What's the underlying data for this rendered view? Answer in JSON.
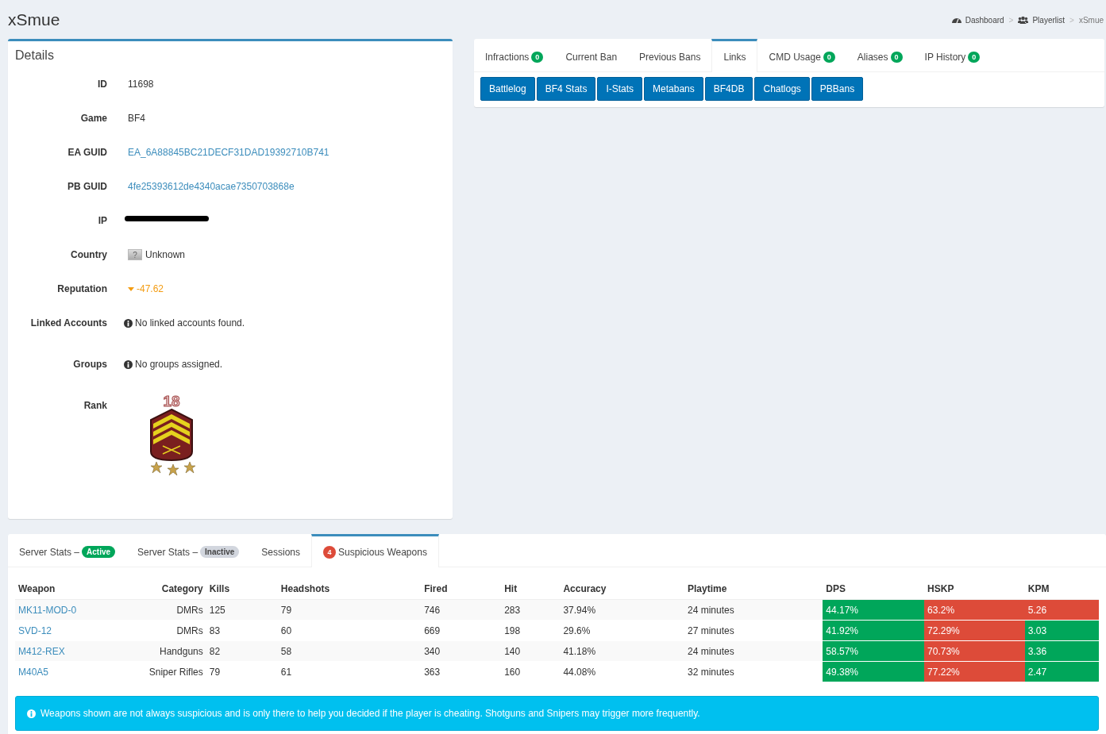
{
  "page_title": "xSmue",
  "breadcrumb": [
    {
      "label": "Dashboard",
      "kind": "dashboard",
      "separator": ">"
    },
    {
      "label": "Playerlist",
      "kind": "players",
      "separator": ">"
    },
    {
      "label": "xSmue",
      "kind": "current"
    }
  ],
  "details": {
    "title": "Details",
    "rows": [
      {
        "label": "ID",
        "kind": "text",
        "value": "11698"
      },
      {
        "label": "Game",
        "kind": "text",
        "value": "BF4"
      },
      {
        "label": "EA GUID",
        "kind": "link",
        "value": "EA_6A88845BC21DECF31DAD19392710B741"
      },
      {
        "label": "PB GUID",
        "kind": "link",
        "value": "4fe25393612de4340acae7350703868e"
      },
      {
        "label": "IP",
        "kind": "redacted"
      },
      {
        "label": "Country",
        "kind": "flag",
        "flag_glyph": "?",
        "value": "Unknown"
      },
      {
        "label": "Reputation",
        "kind": "reputation",
        "falling": true,
        "value": "-47.62"
      },
      {
        "label": "Linked Accounts",
        "kind": "info",
        "value": "No linked accounts found."
      },
      {
        "label": "Groups",
        "kind": "info",
        "value": "No groups assigned."
      },
      {
        "label": "Rank",
        "kind": "rank",
        "value": "18"
      }
    ]
  },
  "links_panel": {
    "tabs": [
      {
        "label": "Infractions",
        "count": "0",
        "selected": false
      },
      {
        "label": "Current Ban",
        "selected": false
      },
      {
        "label": "Previous Bans",
        "selected": false
      },
      {
        "label": "Links",
        "selected": true
      },
      {
        "label": "CMD Usage",
        "count": "0",
        "selected": false
      },
      {
        "label": "Aliases",
        "count": "0",
        "selected": false
      },
      {
        "label": "IP History",
        "count": "0",
        "selected": false
      }
    ],
    "buttons": [
      "Battlelog",
      "BF4 Stats",
      "I-Stats",
      "Metabans",
      "BF4DB",
      "Chatlogs",
      "PBBans"
    ]
  },
  "stats_panel": {
    "tabs": [
      {
        "label": "Server Stats –",
        "badge": "Active",
        "active": true,
        "selected": false
      },
      {
        "label": "Server Stats –",
        "badge": "Inactive",
        "active": false,
        "selected": false
      },
      {
        "label": "Sessions",
        "selected": false
      },
      {
        "label": "Suspicious Weapons",
        "count": "4",
        "selected": true
      }
    ],
    "table": {
      "columns": [
        "Weapon",
        "Category",
        "Kills",
        "Headshots",
        "Fired",
        "Hit",
        "Accuracy",
        "Playtime",
        "DPS",
        "HSKP",
        "KPM"
      ],
      "rows": [
        {
          "weapon": "MK11-MOD-0",
          "category": "DMRs",
          "kills": "125",
          "headshots": "79",
          "fired": "746",
          "hit": "283",
          "accuracy": "37.94%",
          "playtime": "24 minutes",
          "dps": {
            "value": "44.17%",
            "flagged": false
          },
          "hskp": {
            "value": "63.2%",
            "flagged": true
          },
          "kpm": {
            "value": "5.26",
            "flagged": true
          }
        },
        {
          "weapon": "SVD-12",
          "category": "DMRs",
          "kills": "83",
          "headshots": "60",
          "fired": "669",
          "hit": "198",
          "accuracy": "29.6%",
          "playtime": "27 minutes",
          "dps": {
            "value": "41.92%",
            "flagged": false
          },
          "hskp": {
            "value": "72.29%",
            "flagged": true
          },
          "kpm": {
            "value": "3.03",
            "flagged": false
          }
        },
        {
          "weapon": "M412-REX",
          "category": "Handguns",
          "kills": "82",
          "headshots": "58",
          "fired": "340",
          "hit": "140",
          "accuracy": "41.18%",
          "playtime": "24 minutes",
          "dps": {
            "value": "58.57%",
            "flagged": false
          },
          "hskp": {
            "value": "70.73%",
            "flagged": true
          },
          "kpm": {
            "value": "3.36",
            "flagged": false
          }
        },
        {
          "weapon": "M40A5",
          "category": "Sniper Rifles",
          "kills": "79",
          "headshots": "61",
          "fired": "363",
          "hit": "160",
          "accuracy": "44.08%",
          "playtime": "32 minutes",
          "dps": {
            "value": "49.38%",
            "flagged": false
          },
          "hskp": {
            "value": "77.22%",
            "flagged": true
          },
          "kpm": {
            "value": "2.47",
            "flagged": false
          }
        }
      ]
    },
    "alert": "Weapons shown are not always suspicious and is only there to help you decided if the player is cheating. Shotguns and Snipers may trigger more frequently."
  }
}
